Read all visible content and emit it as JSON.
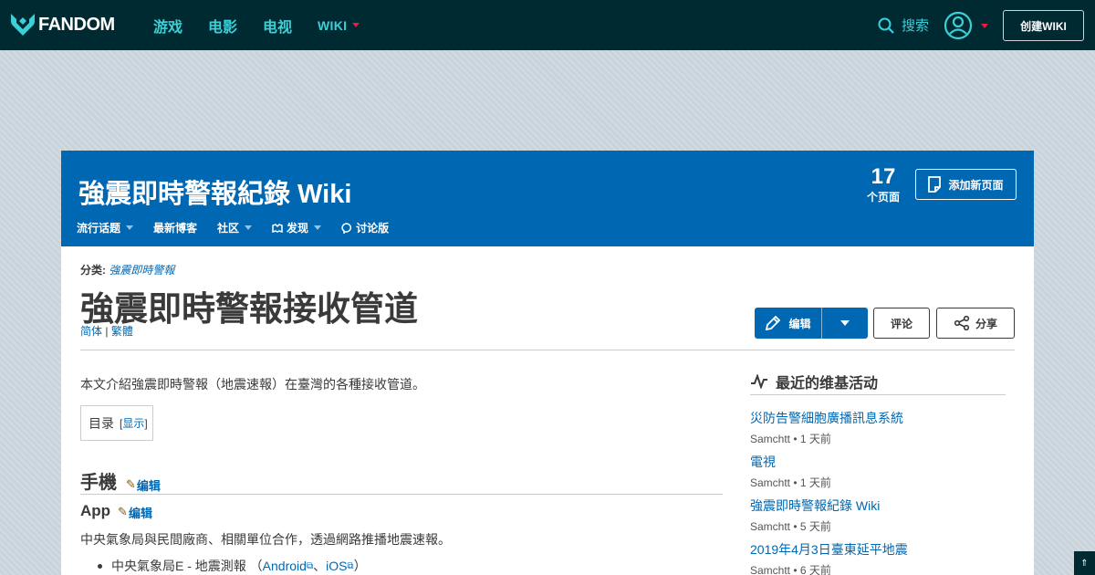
{
  "global_nav": {
    "logo_text": "FANDOM",
    "links": [
      "游戏",
      "电影",
      "电视",
      "WIKI"
    ],
    "search_label": "搜索",
    "create_wiki": "创建WIKI"
  },
  "community": {
    "wiki_name": "強震即時警報紀錄 Wiki",
    "page_count": "17",
    "page_count_unit": "个页面",
    "add_page": "添加新页面",
    "nav": [
      "流行话题",
      "最新博客",
      "社区",
      "发现",
      "讨论版"
    ]
  },
  "article": {
    "category_label": "分类:",
    "category": "強震即時警報",
    "title": "強震即時警報接收管道",
    "variant_simplified": "简体",
    "variant_sep": " | ",
    "variant_traditional": "繁體",
    "edit_label": "编辑",
    "comment_label": "评论",
    "share_label": "分享",
    "intro": "本文介紹強震即時警報（地震速報）在臺灣的各種接收管道。",
    "toc_label": "目录",
    "toc_show": "显示",
    "section_h2": "手機",
    "section_h3": "App",
    "section_edit": "编辑",
    "section_para": "中央氣象局與民間廠商、相關單位合作，透過網路推播地震速報。",
    "list_item_text": "中央氣象局E - 地震測報 （",
    "list_link_android": "Android",
    "list_sep": "、",
    "list_link_ios": "iOS",
    "list_close": "）"
  },
  "rail": {
    "title": "最近的维基活动",
    "items": [
      {
        "title": "災防告警細胞廣播訊息系統",
        "meta": "Samchtt • 1 天前"
      },
      {
        "title": "電視",
        "meta": "Samchtt • 1 天前"
      },
      {
        "title": "強震即時警報紀錄 Wiki",
        "meta": "Samchtt • 5 天前"
      },
      {
        "title": "2019年4月3日臺東延平地震",
        "meta": "Samchtt • 6 天前"
      }
    ]
  },
  "colors": {
    "global_nav_bg": "#002a32",
    "accent_teal": "#3ccfd6",
    "community_blue": "#0067b2",
    "link": "#0067b2"
  }
}
